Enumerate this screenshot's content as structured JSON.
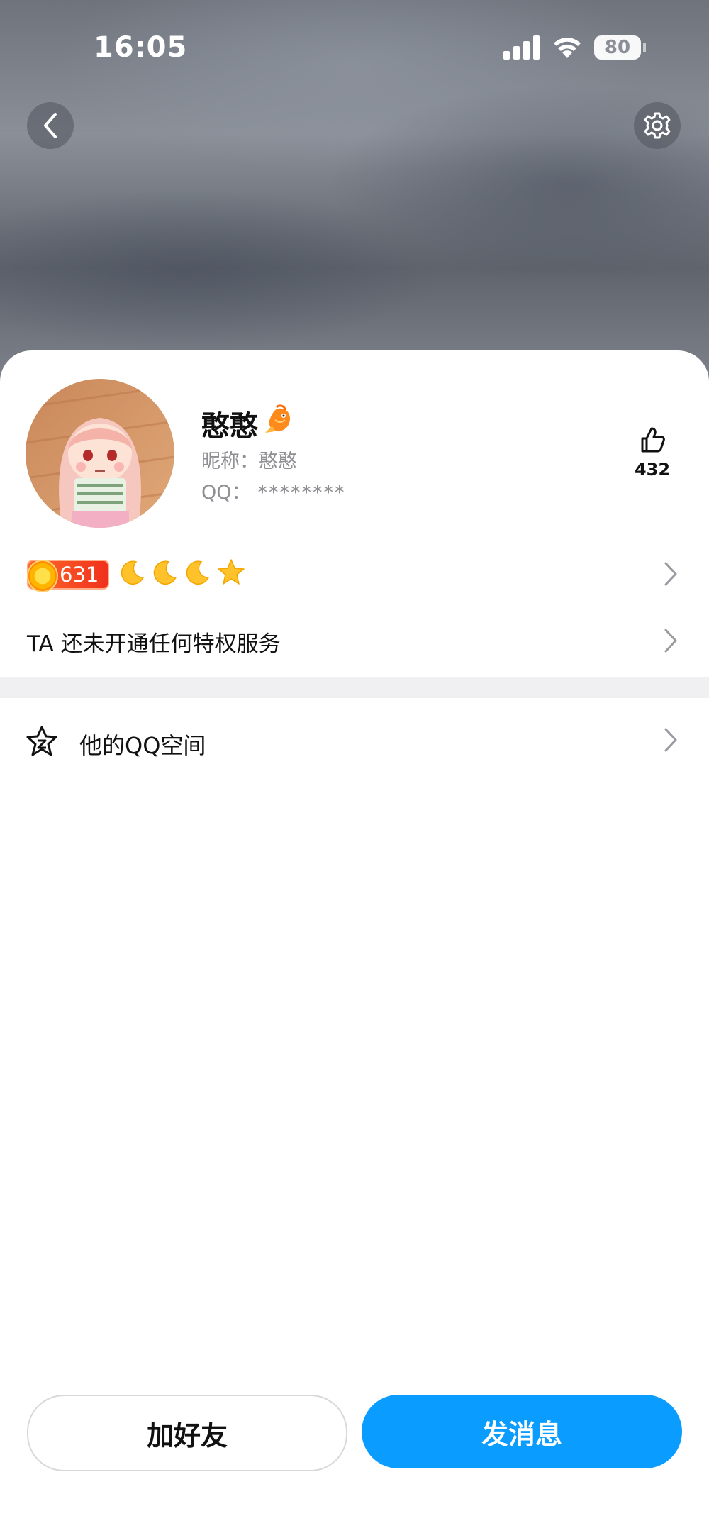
{
  "status_bar": {
    "time": "16:05",
    "battery": "80",
    "signal_icon": "cellular-signal-icon",
    "wifi_icon": "wifi-icon"
  },
  "header": {
    "back_icon": "chevron-left-icon",
    "settings_icon": "gear-icon"
  },
  "profile": {
    "name": "憨憨",
    "badge_icon": "goldfish-icon",
    "nickname_label": "昵称：",
    "nickname": "憨憨",
    "qq_label": "QQ：",
    "qq_number": "********",
    "like_icon": "thumbs-up-icon",
    "like_count": "432"
  },
  "level": {
    "coin_value": "631",
    "icons": [
      "moon-icon",
      "moon-icon",
      "moon-icon",
      "star-icon"
    ]
  },
  "privilege": {
    "text": "TA 还未开通任何特权服务"
  },
  "qzone": {
    "icon": "qzone-star-icon",
    "label": "他的QQ空间"
  },
  "actions": {
    "add_friend": "加好友",
    "send_message": "发消息"
  },
  "colors": {
    "primary": "#0a9cff",
    "coin_badge": "#f0311c",
    "muted_text": "#8e8e93"
  }
}
